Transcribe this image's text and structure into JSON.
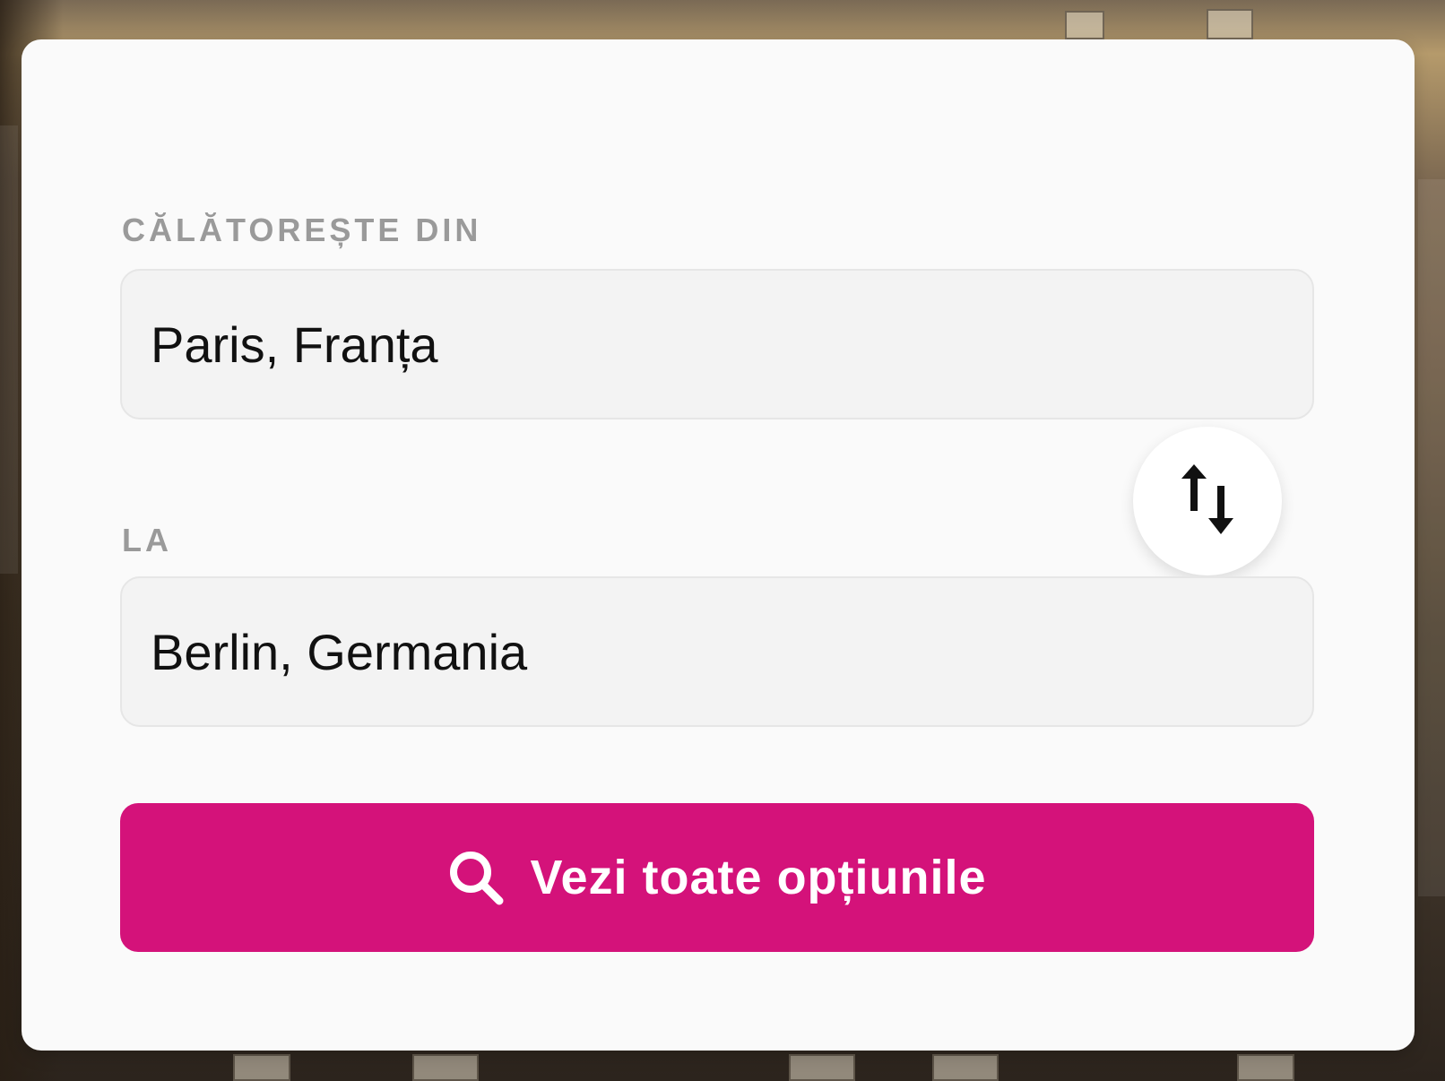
{
  "form": {
    "from_label": "CĂLĂTOREȘTE DIN",
    "from_value": "Paris, Franța",
    "to_label": "LA",
    "to_value": "Berlin, Germania",
    "search_label": "Vezi toate opțiunile"
  },
  "colors": {
    "accent": "#d4127a",
    "card": "#fafafa",
    "field_bg": "#f3f3f3",
    "label": "#9a9a9a"
  },
  "icons": {
    "swap": "swap-vertical-icon",
    "search": "search-icon"
  }
}
